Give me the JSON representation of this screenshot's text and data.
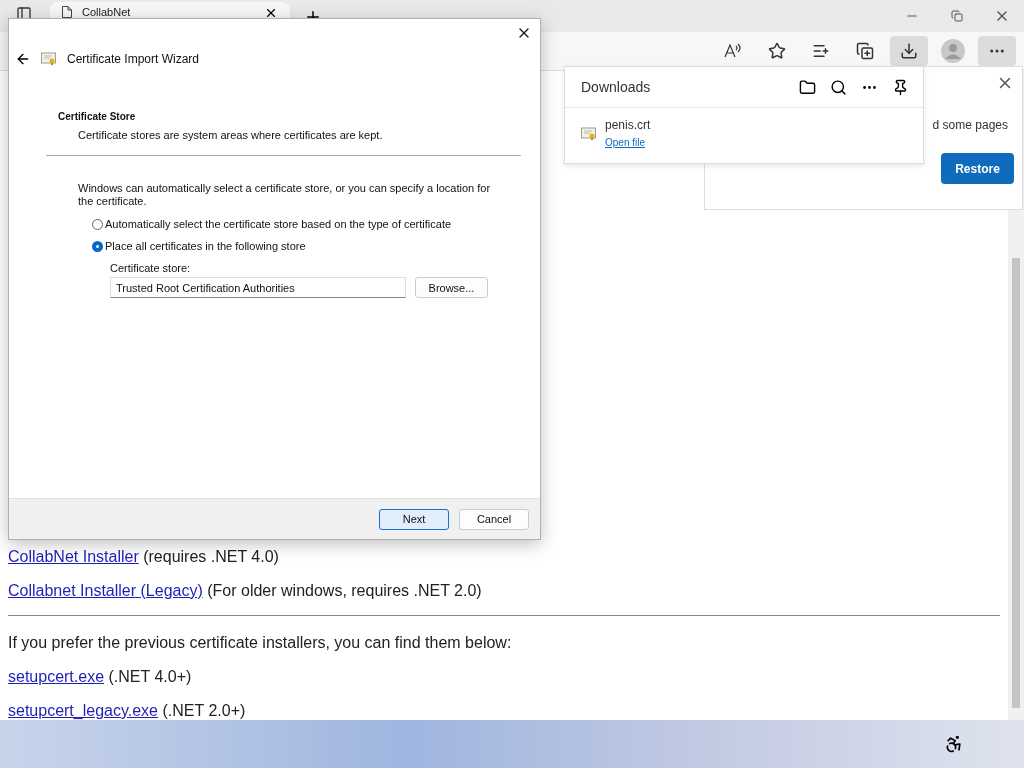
{
  "browser": {
    "tab": {
      "title": "CollabNet"
    },
    "toolbar_buttons": [
      {
        "kind": "read-aloud",
        "selected": false
      },
      {
        "kind": "add-favorite",
        "selected": false
      },
      {
        "kind": "favorites",
        "selected": false
      },
      {
        "kind": "collections",
        "selected": false
      },
      {
        "kind": "downloads",
        "selected": true
      },
      {
        "kind": "profile",
        "selected": false
      },
      {
        "kind": "more",
        "selected": true
      }
    ]
  },
  "downloads": {
    "title": "Downloads",
    "items": [
      {
        "name": "penis.crt",
        "action": "Open file"
      }
    ]
  },
  "notification": {
    "text": "d some pages",
    "button": "Restore"
  },
  "page": {
    "installers": [
      {
        "link": "CollabNet Installer",
        "note": "(requires .NET 4.0)"
      },
      {
        "link": "Collabnet Installer (Legacy)",
        "note": "(For older windows, requires .NET 2.0)"
      }
    ],
    "intro": "If you prefer the previous certificate installers, you can find them below:",
    "legacy_installers": [
      {
        "link": "setupcert.exe",
        "note": "(.NET 4.0+)"
      },
      {
        "link": "setupcert_legacy.exe",
        "note": "(.NET 2.0+)"
      }
    ]
  },
  "wizard": {
    "title": "Certificate Import Wizard",
    "heading": "Certificate Store",
    "subheading": "Certificate stores are system areas where certificates are kept.",
    "description": "Windows can automatically select a certificate store, or you can specify a location for the certificate.",
    "options": [
      {
        "label": "Automatically select the certificate store based on the type of certificate",
        "selected": false
      },
      {
        "label": "Place all certificates in the following store",
        "selected": true
      }
    ],
    "store_label": "Certificate store:",
    "store_value": "Trusted Root Certification Authorities",
    "browse": "Browse...",
    "buttons": [
      {
        "label": "Next",
        "kind": "primary"
      },
      {
        "label": "Cancel",
        "kind": "secondary"
      }
    ]
  }
}
